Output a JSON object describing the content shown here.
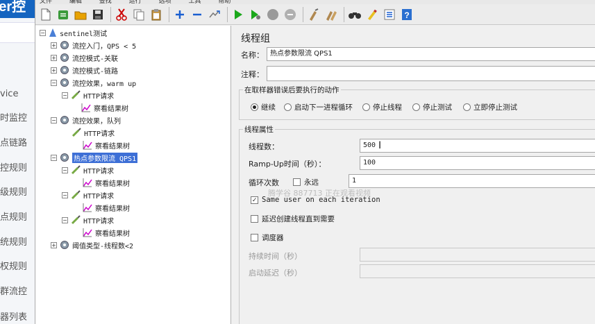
{
  "bg_app": {
    "brand": "ner控",
    "items": [
      "vice",
      "时监控",
      "点链路",
      "控规则",
      "级规则",
      "点规则",
      "统规则",
      "权规则",
      "群流控",
      "器列表"
    ]
  },
  "menu": [
    "文件",
    "编辑",
    "查找",
    "运行",
    "选项",
    "工具",
    "帮助"
  ],
  "toolbar_icons": [
    "new-icon",
    "templates-icon",
    "open-icon",
    "save-icon",
    "cut-icon",
    "copy-icon",
    "paste-icon",
    "expand-icon",
    "collapse-icon",
    "toggle-icon",
    "start-icon",
    "start-no-pause-icon",
    "stop-icon",
    "shutdown-icon",
    "clear-icon",
    "clear-all-icon",
    "search-icon",
    "reset-search-icon",
    "function-helper-icon",
    "help-icon"
  ],
  "tree": {
    "root": "sentinel测试",
    "groups": [
      {
        "label": "流控入门，QPS < 5",
        "children": []
      },
      {
        "label": "流控模式-关联",
        "children": []
      },
      {
        "label": "流控模式-链路",
        "children": []
      },
      {
        "label": "流控效果，warm up",
        "children": [
          {
            "label": "HTTP请求",
            "listener": "察看结果树"
          }
        ]
      },
      {
        "label": "流控效果，队列",
        "children": [
          {
            "label": "HTTP请求",
            "listener": "察看结果树"
          }
        ]
      },
      {
        "label": "热点参数限流 QPS1",
        "selected": true,
        "children": [
          {
            "label": "HTTP请求",
            "listener": "察看结果树"
          },
          {
            "label": "HTTP请求",
            "listener": "察看结果树"
          },
          {
            "label": "HTTP请求",
            "listener": "察看结果树"
          }
        ]
      },
      {
        "label": "阈值类型-线程数<2",
        "children": []
      }
    ]
  },
  "panel": {
    "title": "线程组",
    "name_label": "名称：",
    "name_value": "热点参数限流 QPS1",
    "comment_label": "注释：",
    "comment_value": "",
    "error_group_title": "在取样器错误后要执行的动作",
    "error_actions": [
      "继续",
      "启动下一进程循环",
      "停止线程",
      "停止测试",
      "立即停止测试"
    ],
    "error_selected": 0,
    "thread_group_title": "线程属性",
    "threads_label": "线程数：",
    "threads_value": "500",
    "rampup_label": "Ramp-Up时间（秒）：",
    "rampup_value": "100",
    "loop_label": "循环次数",
    "forever_label": "永远",
    "loop_value": "1",
    "same_user_label": "Same user on each iteration",
    "same_user_checked": true,
    "delay_label": "延迟创建线程直到需要",
    "scheduler_label": "调度器",
    "duration_label": "持续时间（秒）",
    "startup_delay_label": "启动延迟（秒）",
    "watermark": "腾学谷 887713 正在观看视频"
  }
}
